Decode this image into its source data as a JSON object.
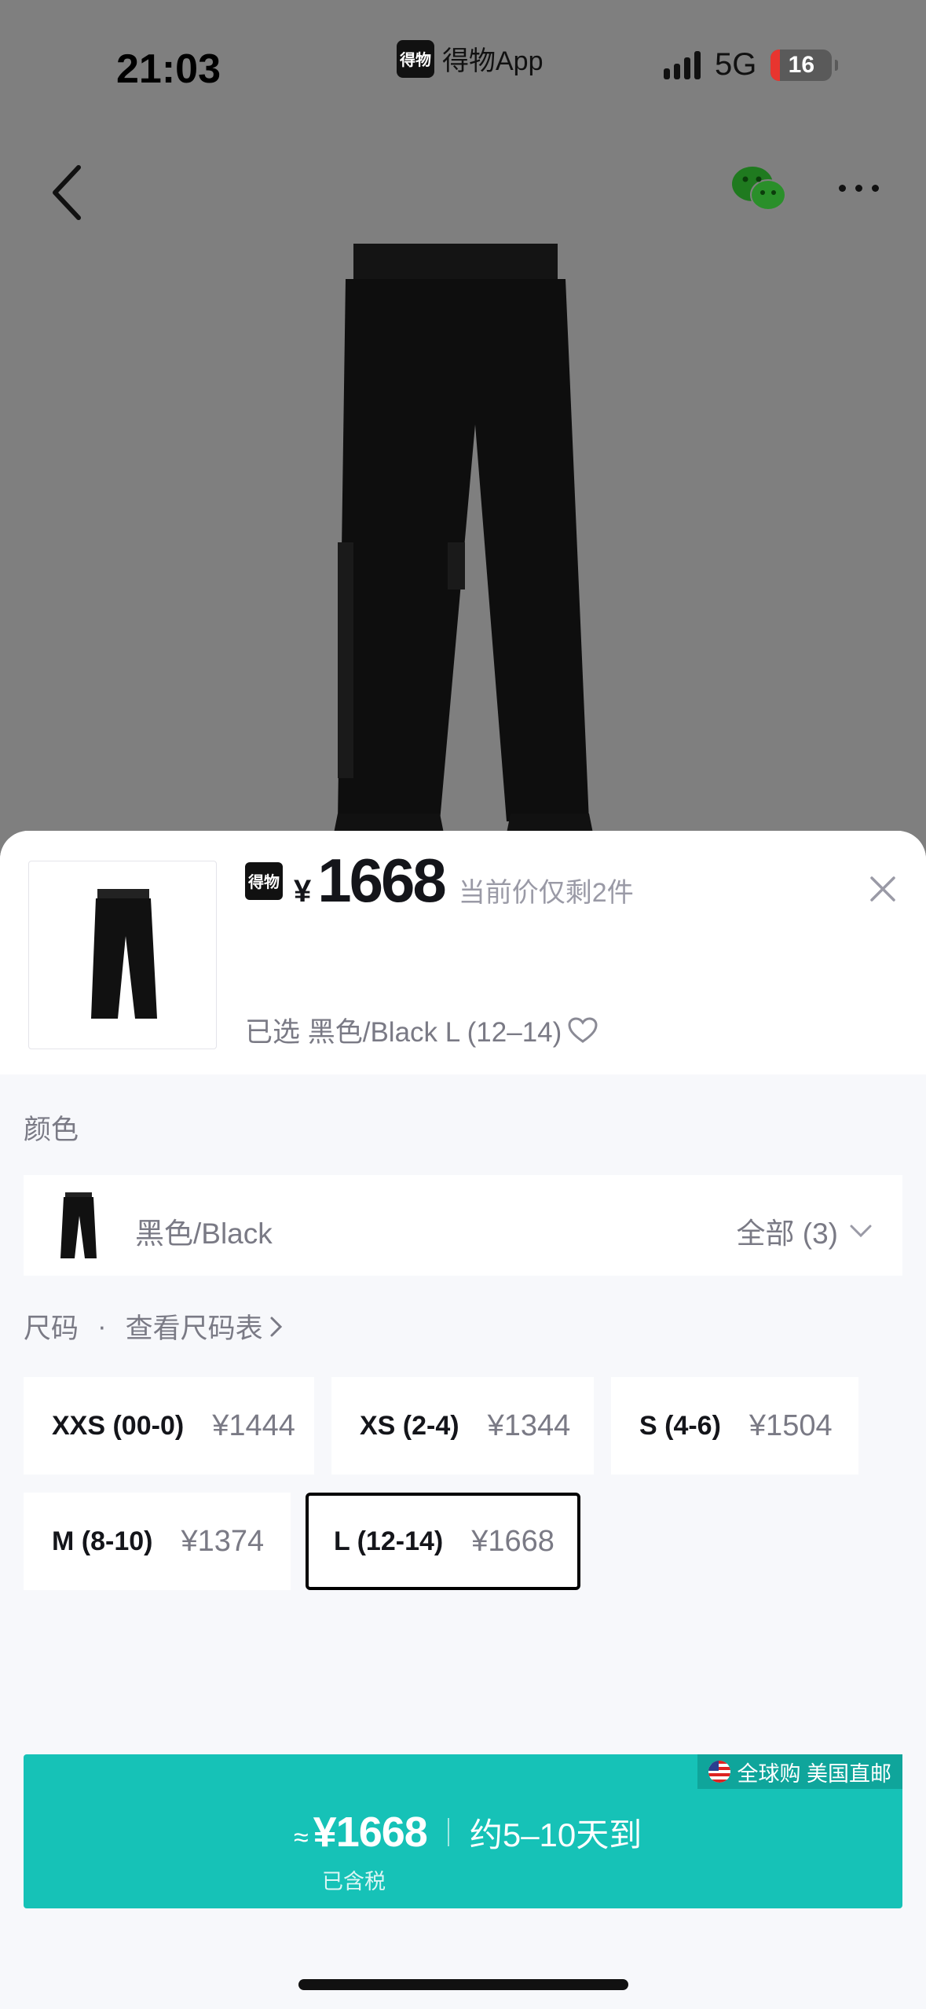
{
  "status_bar": {
    "time": "21:03",
    "app_name": "得物App",
    "app_badge": "得物",
    "network": "5G",
    "battery": "16"
  },
  "nav": {
    "back_icon": "chevron-left-icon",
    "share_icon": "wechat-icon",
    "more_icon": "more-icon"
  },
  "product": {
    "badge": "得物",
    "currency": "¥",
    "price": "1668",
    "stock_note": "当前价仅剩2件",
    "selected_text": "已选 黑色/Black L (12–14)"
  },
  "color_section": {
    "label": "颜色",
    "selected_color": "黑色/Black",
    "all_label": "全部 (3)"
  },
  "size_section": {
    "label": "尺码",
    "chart_link": "查看尺码表",
    "sizes": [
      {
        "size": "XXS (00-0)",
        "price": "¥1444"
      },
      {
        "size": "XS (2-4)",
        "price": "¥1344"
      },
      {
        "size": "S (4-6)",
        "price": "¥1504"
      },
      {
        "size": "M (8-10)",
        "price": "¥1374"
      },
      {
        "size": "L (12-14)",
        "price": "¥1668"
      }
    ],
    "selected_index": 4
  },
  "buy_bar": {
    "tag": "全球购 美国直邮",
    "approx": "≈",
    "price": "¥1668",
    "eta": "约5–10天到",
    "tax_note": "已含税",
    "color": "#16c2b7"
  }
}
